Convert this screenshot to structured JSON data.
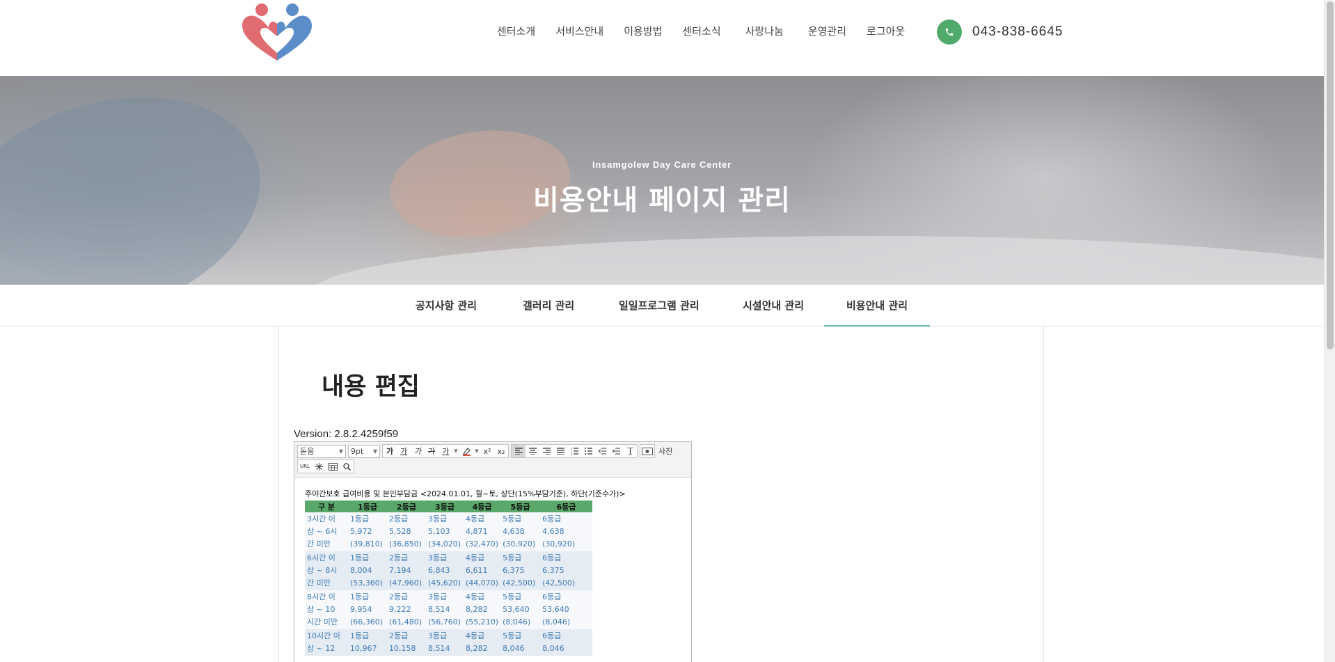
{
  "header": {
    "nav": [
      "센터소개",
      "서비스안내",
      "이용방법",
      "센터소식",
      "사랑나눔",
      "운영관리",
      "로그아웃"
    ],
    "phone_icon": "phone-icon",
    "phone": "043-838-6645",
    "colors": {
      "accent_green": "#4faa6b",
      "logo_red": "#e06b70",
      "logo_blue": "#5b8ec9"
    }
  },
  "hero": {
    "subtitle": "Insamgolew Day Care Center",
    "title": "비용안내 페이지 관리"
  },
  "subtabs": [
    "공지사항 관리",
    "갤러리 관리",
    "일일프로그램 관리",
    "시설안내 관리",
    "비용안내 관리"
  ],
  "content": {
    "title": "내용 편집",
    "version": "Version: 2.8.2.4259f59"
  },
  "editor": {
    "font": "돋움",
    "size": "9pt",
    "format_buttons": [
      "가",
      "가",
      "가",
      "가",
      "가"
    ],
    "photo_label": "사진",
    "url_label": "URL",
    "caption": "주야간보호 급여비용 및 본인부담금 <2024.01.01, 월~토, 상단(15%부담기준), 하단(기준수가)>",
    "table_headers": [
      "구 분",
      "1등급",
      "2등급",
      "3등급",
      "4등급",
      "5등급",
      "6등급"
    ],
    "rows": [
      {
        "label": [
          "3시간 이",
          "상 ~ 6시",
          "간 미만"
        ],
        "cells": [
          [
            "1등급",
            "5,972",
            "(39,810)"
          ],
          [
            "2등급",
            "5,528",
            "(36,850)"
          ],
          [
            "3등급",
            "5,103",
            "(34,020)"
          ],
          [
            "4등급",
            "4,871",
            "(32,470)"
          ],
          [
            "5등급",
            "4,638",
            "(30,920)"
          ],
          [
            "6등급",
            "4,638",
            "(30,920)"
          ]
        ]
      },
      {
        "label": [
          "6시간 이",
          "상 ~ 8시",
          "간 미만"
        ],
        "cells": [
          [
            "1등급",
            "8,004",
            "(53,360)"
          ],
          [
            "2등급",
            "7,194",
            "(47,960)"
          ],
          [
            "3등급",
            "6,843",
            "(45,620)"
          ],
          [
            "4등급",
            "6,611",
            "(44,070)"
          ],
          [
            "5등급",
            "6,375",
            "(42,500)"
          ],
          [
            "6등급",
            "6,375",
            "(42,500)"
          ]
        ]
      },
      {
        "label": [
          "8시간 이",
          "상 ~ 10",
          "시간 미만"
        ],
        "cells": [
          [
            "1등급",
            "9,954",
            "(66,360)"
          ],
          [
            "2등급",
            "9,222",
            "(61,480)"
          ],
          [
            "3등급",
            "8,514",
            "(56,760)"
          ],
          [
            "4등급",
            "8,282",
            "(55,210)"
          ],
          [
            "5등급",
            "53,640",
            "(8,046)"
          ],
          [
            "6등급",
            "53,640",
            "(8,046)"
          ]
        ]
      },
      {
        "label": [
          "10시간 이",
          "상 ~ 12"
        ],
        "cells": [
          [
            "1등급",
            "10,967"
          ],
          [
            "2등급",
            "10,158"
          ],
          [
            "3등급",
            "8,514"
          ],
          [
            "4등급",
            "8,282"
          ],
          [
            "5등급",
            "8,046"
          ],
          [
            "6등급",
            "8,046"
          ]
        ]
      }
    ]
  }
}
